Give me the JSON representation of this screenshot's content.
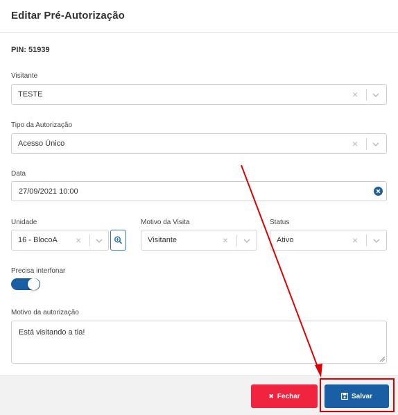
{
  "modal": {
    "title": "Editar Pré-Autorização"
  },
  "pin": "PIN: 51939",
  "fields": {
    "visitante": {
      "label": "Visitante",
      "value": "TESTE"
    },
    "tipo": {
      "label": "Tipo da Autorização",
      "value": "Acesso Único"
    },
    "data": {
      "label": "Data",
      "value": "27/09/2021 10:00"
    },
    "unidade": {
      "label": "Unidade",
      "value": "16 - BlocoA"
    },
    "motivo_visita": {
      "label": "Motivo da Visita",
      "value": "Visitante"
    },
    "status": {
      "label": "Status",
      "value": "Ativo"
    },
    "interfonar": {
      "label": "Precisa interfonar",
      "checked": true
    },
    "motivo_autorizacao": {
      "label": "Motivo da autorização",
      "value": "Está visitando a tia!"
    }
  },
  "icons": {
    "clear": "×",
    "fechar": "✖"
  },
  "footer": {
    "fechar_label": "Fechar",
    "salvar_label": "Salvar"
  },
  "colors": {
    "primary": "#1a5ea4",
    "danger": "#f0243f",
    "annotation": "#e00000"
  }
}
